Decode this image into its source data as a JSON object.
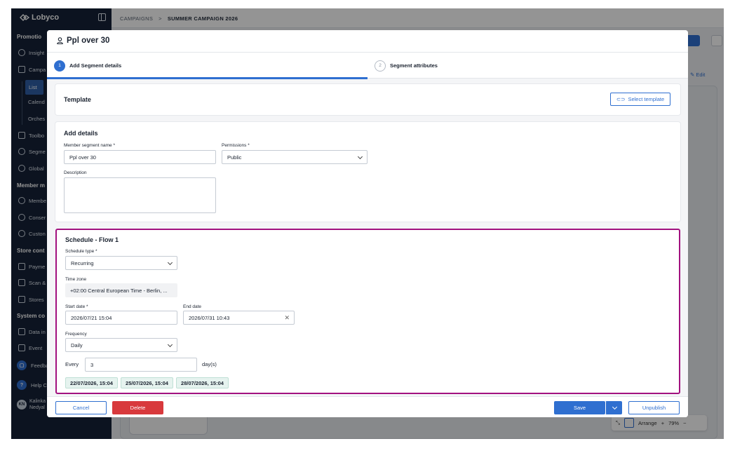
{
  "app": {
    "name": "Lobyco"
  },
  "sidebar": {
    "sections": [
      "Promotio",
      "Member m",
      "Store cont",
      "System co"
    ],
    "items": [
      {
        "label": "Insight",
        "icon": "bulb-icon"
      },
      {
        "label": "Campa",
        "icon": "megaphone-icon"
      },
      {
        "label": "Toolbo",
        "icon": "toolbox-icon"
      },
      {
        "label": "Segme",
        "icon": "segment-icon"
      },
      {
        "label": "Global",
        "icon": "gear-icon"
      },
      {
        "label": "Membe",
        "icon": "heart-icon"
      },
      {
        "label": "Conser",
        "icon": "check-circle-icon"
      },
      {
        "label": "Custon",
        "icon": "chat-icon"
      },
      {
        "label": "Payme",
        "icon": "card-icon"
      },
      {
        "label": "Scan &",
        "icon": "scan-icon"
      },
      {
        "label": "Stores",
        "icon": "store-icon"
      },
      {
        "label": "Data in",
        "icon": "import-icon"
      },
      {
        "label": "Event",
        "icon": "event-icon"
      }
    ],
    "subitems": [
      "List",
      "Calend",
      "Orches"
    ],
    "feedback": "Feedba",
    "help": "Help C",
    "user": {
      "initials": "KN",
      "line1": "Kalinka",
      "line2": "Nedyal"
    }
  },
  "breadcrumb": {
    "parent": "CAMPAIGNS",
    "separator": ">",
    "current": "SUMMER CAMPAIGN 2026"
  },
  "background": {
    "edit_label": "Edit",
    "arrange_label": "Arrange",
    "zoom": "79%"
  },
  "modal": {
    "title": "Ppl over 30",
    "steps": [
      {
        "num": "1",
        "label": "Add Segment details"
      },
      {
        "num": "2",
        "label": "Segment attributes"
      }
    ],
    "template": {
      "title": "Template",
      "button": "Select template"
    },
    "details": {
      "title": "Add details",
      "name_label": "Member segment name *",
      "name_value": "Ppl over 30",
      "permissions_label": "Permissions *",
      "permissions_value": "Public",
      "description_label": "Description",
      "description_value": ""
    },
    "schedule": {
      "title": "Schedule - Flow 1",
      "type_label": "Schedule type *",
      "type_value": "Recurring",
      "timezone_label": "Time zone",
      "timezone_value": "+02:00 Central European Time - Berlin, ...",
      "start_label": "Start date *",
      "start_value": "2026/07/21 15:04",
      "end_label": "End date",
      "end_value": "2026/07/31 10:43",
      "frequency_label": "Frequency",
      "frequency_value": "Daily",
      "every_label": "Every",
      "every_value": "3",
      "every_unit": "day(s)",
      "occurrences": [
        "22/07/2026, 15:04",
        "25/07/2026, 15:04",
        "28/07/2026, 15:04"
      ]
    },
    "footer": {
      "cancel": "Cancel",
      "delete": "Delete",
      "save": "Save",
      "unpublish": "Unpublish"
    }
  },
  "colors": {
    "primary": "#2f6fd0",
    "danger": "#d8393c",
    "highlight": "#a2117f",
    "sidebar": "#152238"
  }
}
